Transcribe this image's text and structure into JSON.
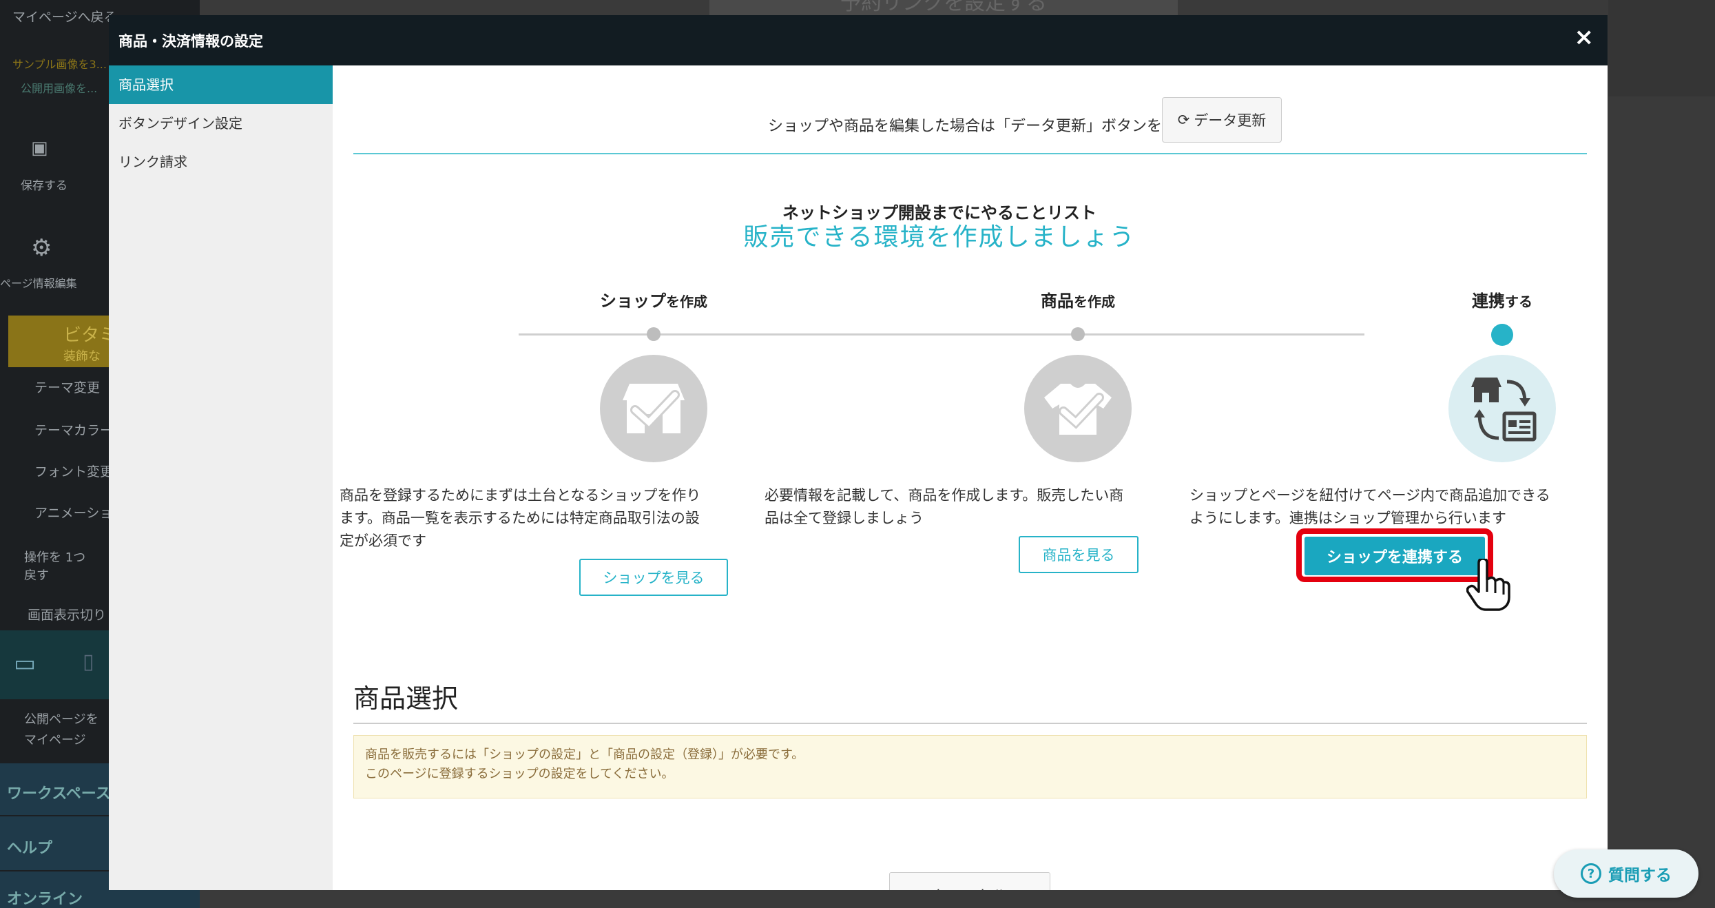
{
  "background": {
    "sidebar": {
      "back_link": "マイページへ戻る",
      "sample_note": "サンプル画像を3...",
      "public_badge": "公開用画像を...",
      "save_label": "保存する",
      "page_info_label": "ページ情報編集",
      "vitamin_label": "ビタミ",
      "vitamin_sub": "装飾な",
      "theme_change": "テーマ変更",
      "theme_color": "テーマカラー",
      "font_change": "フォント変更",
      "animation": "アニメーション",
      "undo_label": "操作を 1つ戻す",
      "screen_toggle": "画面表示切り",
      "public_page": "公開ページを",
      "my_page": "マイページ",
      "workspace": "ワークスペース",
      "help": "ヘルプ",
      "online": "オンライン"
    },
    "top_button": "予約リンクを設定する"
  },
  "modal": {
    "title": "商品・決済情報の設定",
    "close_icon": "×",
    "nav": [
      {
        "label": "商品選択",
        "active": true
      },
      {
        "label": "ボタンデザイン設定",
        "active": false
      },
      {
        "label": "リンク請求",
        "active": false
      }
    ],
    "notice_text": "ショップや商品を編集した場合は「データ更新」ボタンを押してください",
    "refresh_button": "データ更新",
    "steps_subtitle": "ネットショップ開設までにやることリスト",
    "steps_title": "販売できる環境を作成しましょう",
    "steps": [
      {
        "label_main": "ショップ",
        "label_sub": "を作成",
        "icon": "shop-check-icon",
        "description": "商品を登録するためにまずは土台となるショップを作ります。商品一覧を表示するためには特定商品取引法の設定が必須です",
        "button": "ショップを見る",
        "active": false
      },
      {
        "label_main": "商品",
        "label_sub": "を作成",
        "icon": "product-check-icon",
        "description": "必要情報を記載して、商品を作成します。販売したい商品は全て登録しましょう",
        "button": "商品を見る",
        "active": false
      },
      {
        "label_main": "連携",
        "label_sub": "する",
        "icon": "shop-sync-icon",
        "description": "ショップとページを紐付けてページ内で商品追加できるようにします。連携はショップ管理から行います",
        "button": "ショップを連携する",
        "active": true
      }
    ],
    "section_title": "商品選択",
    "alert_lines": [
      "商品を販売するには「ショップの設定」と「商品の設定（登録）」が必要です。",
      "このページに登録するショップの設定をしてください。"
    ],
    "cancel_button": "キャンセル"
  },
  "ask_button": "質問する",
  "colors": {
    "accent": "#27b3c8",
    "highlight": "#e4000f",
    "modal_header": "#121c22",
    "nav_active": "#1895a8"
  }
}
